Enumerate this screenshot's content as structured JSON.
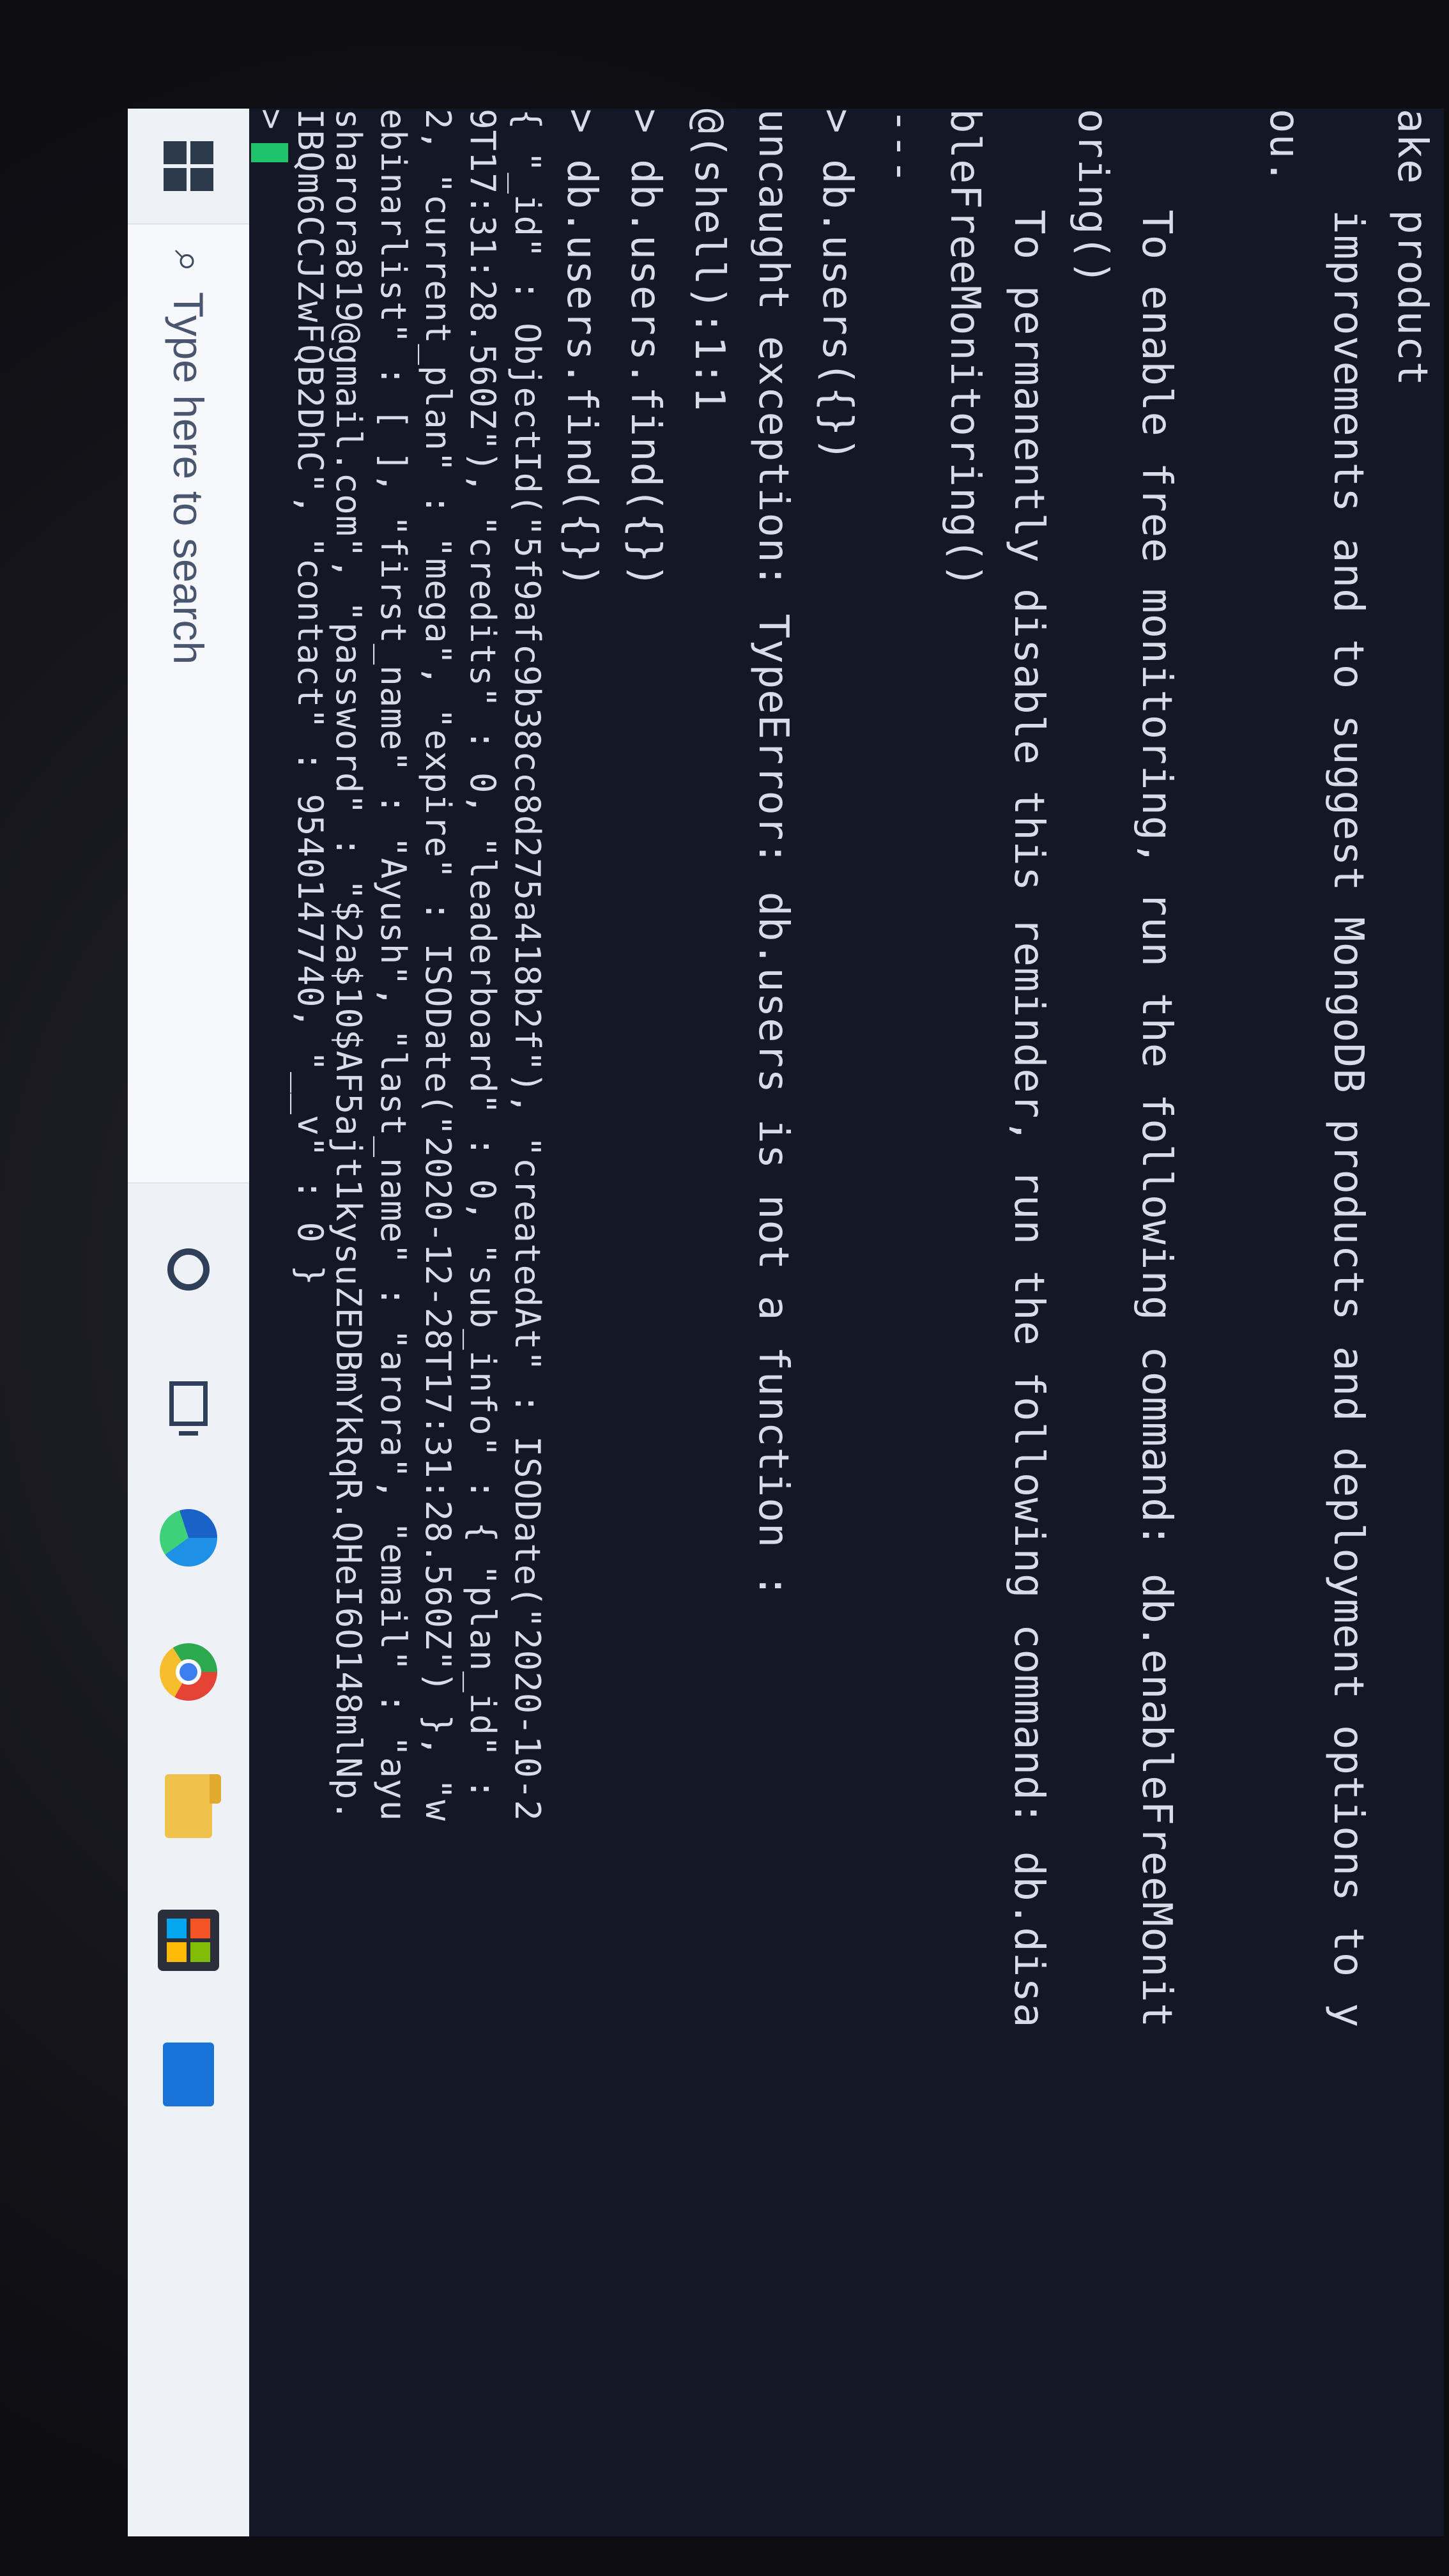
{
  "console": {
    "lines": [
      "ake product",
      "    improvements and to suggest MongoDB products and deployment options to y",
      "ou.",
      "",
      "    To enable free monitoring, run the following command: db.enableFreeMonit",
      "oring()",
      "    To permanently disable this reminder, run the following command: db.disa",
      "bleFreeMonitoring()",
      "---",
      "> db.users({})",
      "uncaught exception: TypeError: db.users is not a function :",
      "@(shell):1:1",
      "> db.users.find({})",
      "> db.users.find({})",
      "{ \"_id\" : ObjectId(\"5f9afc9b38cc8d275a418b2f\"), \"createdAt\" : ISODate(\"2020-10-2",
      "9T17:31:28.560Z\"), \"credits\" : 0, \"leaderboard\" : 0, \"sub_info\" : { \"plan_id\" :",
      "2, \"current_plan\" : \"mega\", \"expire\" : ISODate(\"2020-12-28T17:31:28.560Z\") }, \"w",
      "ebinarlist\" : [ ], \"first_name\" : \"Ayush\", \"last_name\" : \"arora\", \"email\" : \"ayu",
      "sharora819@gmail.com\", \"password\" : \"$2a$10$AF5ajt1kysuZEDBmYkRqR.QHeI6O148mlNp.",
      "IBQm6CCJZwFQB2DhC\", \"contact\" : 9540147740, \"__v\" : 0 }"
    ],
    "prompt": ">"
  },
  "taskbar": {
    "search_placeholder": "Type here to search",
    "icons": [
      "windows-icon",
      "search-icon",
      "cortana-icon",
      "task-view-icon",
      "edge-icon",
      "chrome-icon",
      "file-explorer-icon",
      "store-icon",
      "mail-icon"
    ]
  },
  "colors": {
    "console_bg": "#141826",
    "console_text": "#d6dce8",
    "cursor": "#1fc46a",
    "taskbar_bg": "#eef1f6"
  }
}
